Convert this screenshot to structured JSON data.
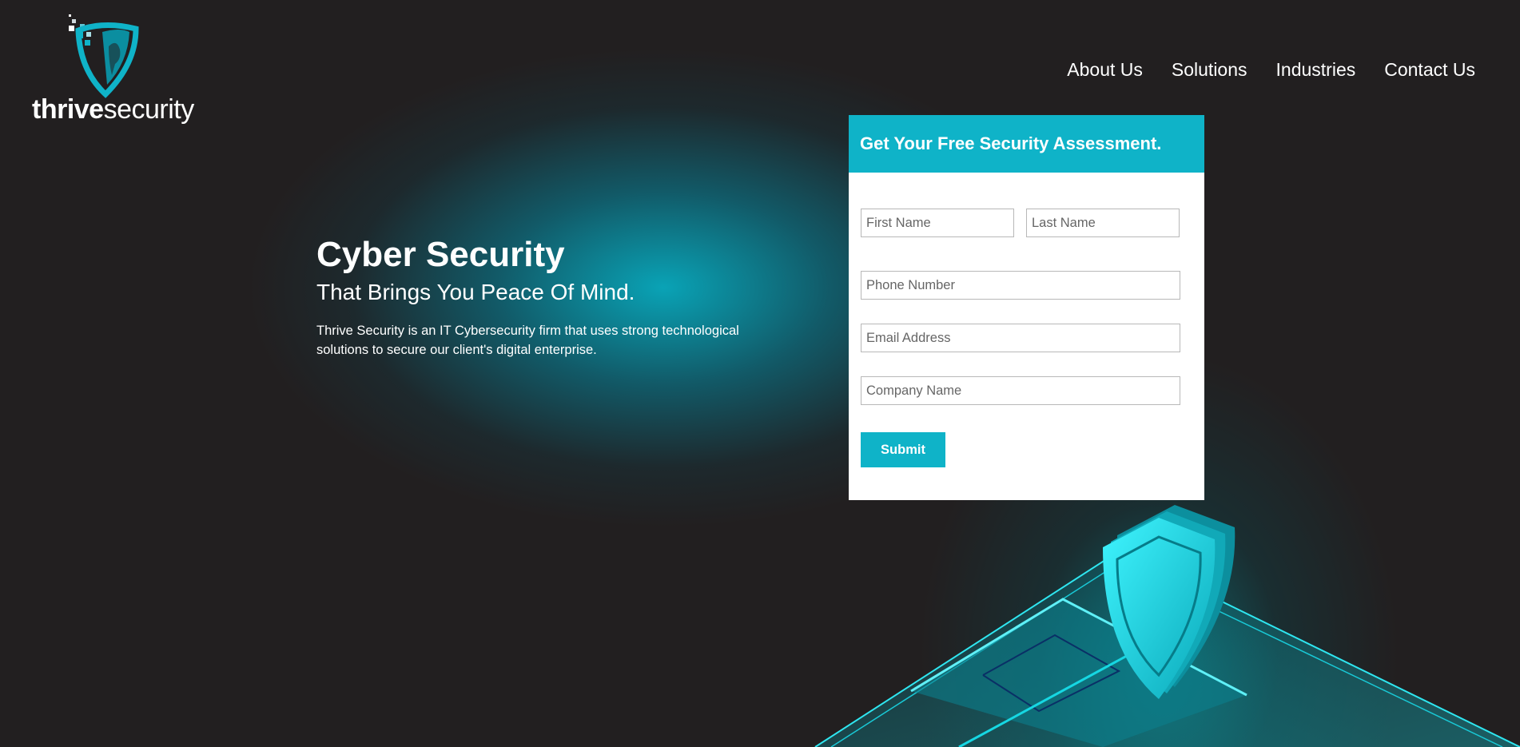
{
  "brand": {
    "name_bold": "thrive",
    "name_light": "security"
  },
  "nav": [
    {
      "label": "About Us"
    },
    {
      "label": "Solutions"
    },
    {
      "label": "Industries"
    },
    {
      "label": "Contact Us"
    }
  ],
  "hero": {
    "title": "Cyber Security",
    "subtitle": "That Brings You Peace Of Mind.",
    "description": "Thrive Security is an IT Cybersecurity firm that uses strong technological solutions to secure our client's digital enterprise."
  },
  "form": {
    "title": "Get Your Free Security Assessment.",
    "first_name_placeholder": "First Name",
    "last_name_placeholder": "Last Name",
    "phone_placeholder": "Phone Number",
    "email_placeholder": "Email Address",
    "company_placeholder": "Company Name",
    "submit_label": "Submit"
  },
  "colors": {
    "accent": "#0fb3c8",
    "background": "#221f20"
  },
  "icons": {
    "logo": "shield-logo-icon",
    "illustration": "isometric-shield-illustration"
  }
}
